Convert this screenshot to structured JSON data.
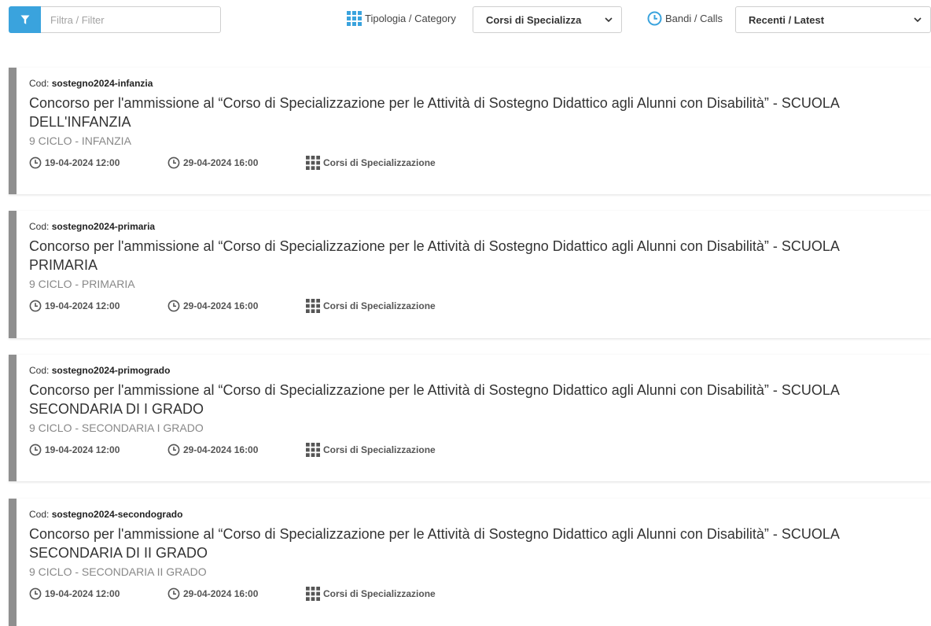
{
  "toolbar": {
    "filter_placeholder": "Filtra / Filter",
    "category_label": "Tipologia / Category",
    "category_value": "Corsi di Specializza",
    "calls_label": "Bandi / Calls",
    "calls_value": "Recenti / Latest"
  },
  "colors": {
    "accent": "#3aa3dd",
    "card_border": "#8f8f8f",
    "subtitle": "#888888"
  },
  "icons": [
    "filter-icon",
    "grid-icon",
    "clock-icon",
    "chevron-down-icon"
  ],
  "cards": [
    {
      "code_label": "Cod:",
      "code": "sostegno2024-infanzia",
      "title": "Concorso per l'ammissione al “Corso di Specializzazione per le Attività di Sostegno Didattico agli Alunni con Disabilità” - SCUOLA DELL'INFANZIA",
      "subtitle": "9 CICLO - INFANZIA",
      "start": "19-04-2024 12:00",
      "end": "29-04-2024 16:00",
      "category": "Corsi di Specializzazione"
    },
    {
      "code_label": "Cod:",
      "code": "sostegno2024-primaria",
      "title": "Concorso per l'ammissione al “Corso di Specializzazione per le Attività di Sostegno Didattico agli Alunni con Disabilità” - SCUOLA PRIMARIA",
      "subtitle": "9 CICLO - PRIMARIA",
      "start": "19-04-2024 12:00",
      "end": "29-04-2024 16:00",
      "category": "Corsi di Specializzazione"
    },
    {
      "code_label": "Cod:",
      "code": "sostegno2024-primogrado",
      "title": "Concorso per l'ammissione al “Corso di Specializzazione per le Attività di Sostegno Didattico agli Alunni con Disabilità” - SCUOLA SECONDARIA DI I GRADO",
      "subtitle": "9 CICLO - SECONDARIA I GRADO",
      "start": "19-04-2024 12:00",
      "end": "29-04-2024 16:00",
      "category": "Corsi di Specializzazione"
    },
    {
      "code_label": "Cod:",
      "code": "sostegno2024-secondogrado",
      "title": "Concorso per l'ammissione al “Corso di Specializzazione per le Attività di Sostegno Didattico agli Alunni con Disabilità” - SCUOLA SECONDARIA DI II GRADO",
      "subtitle": "9 CICLO - SECONDARIA II GRADO",
      "start": "19-04-2024 12:00",
      "end": "29-04-2024 16:00",
      "category": "Corsi di Specializzazione"
    }
  ]
}
